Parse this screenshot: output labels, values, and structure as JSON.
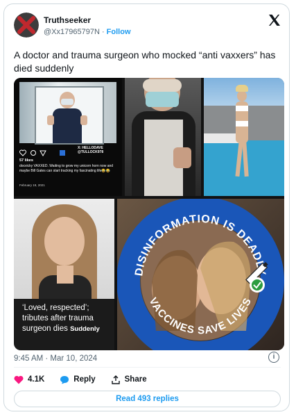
{
  "user": {
    "name": "Truthseeker",
    "handle": "@Xx17965797N",
    "separator": " · ",
    "follow_label": "Follow"
  },
  "tweet": {
    "text": "A doctor and trauma surgeon who mocked “anti vaxxers” has died suddenly"
  },
  "media": {
    "instagram": {
      "likes": "57 likes",
      "caption": "docvicky VAXXED. Waiting to grow my unicorn horn now and maybe Bill Gates can start tracking my fascinating life😂😂",
      "date": "February 19, 2021",
      "watermark_line1": "X: HELLODAVE",
      "watermark_line2": "@TULLOCK978"
    },
    "news_caption": {
      "line1": "‘Loved, respected’;",
      "line2": "tributes after trauma",
      "line3": "surgeon dies",
      "line3_end": "Suddenly"
    },
    "badge": {
      "top_text": "DISINFORMATION IS DEADLY",
      "bottom_text": "VACCINES SAVE LIVES"
    }
  },
  "meta": {
    "timestamp": "9:45 AM · Mar 10, 2024"
  },
  "actions": {
    "likes": "4.1K",
    "reply_label": "Reply",
    "share_label": "Share",
    "read_replies": "Read 493 replies"
  },
  "colors": {
    "link": "#1d9bf0",
    "like": "#f91880",
    "badge_ring": "#1a56b8",
    "text": "#0f1419",
    "muted": "#536471"
  },
  "icons": [
    "x-logo-icon",
    "info-icon",
    "heart-icon",
    "reply-bubble-icon",
    "share-icon",
    "syringe-icon",
    "checkmark-icon"
  ]
}
